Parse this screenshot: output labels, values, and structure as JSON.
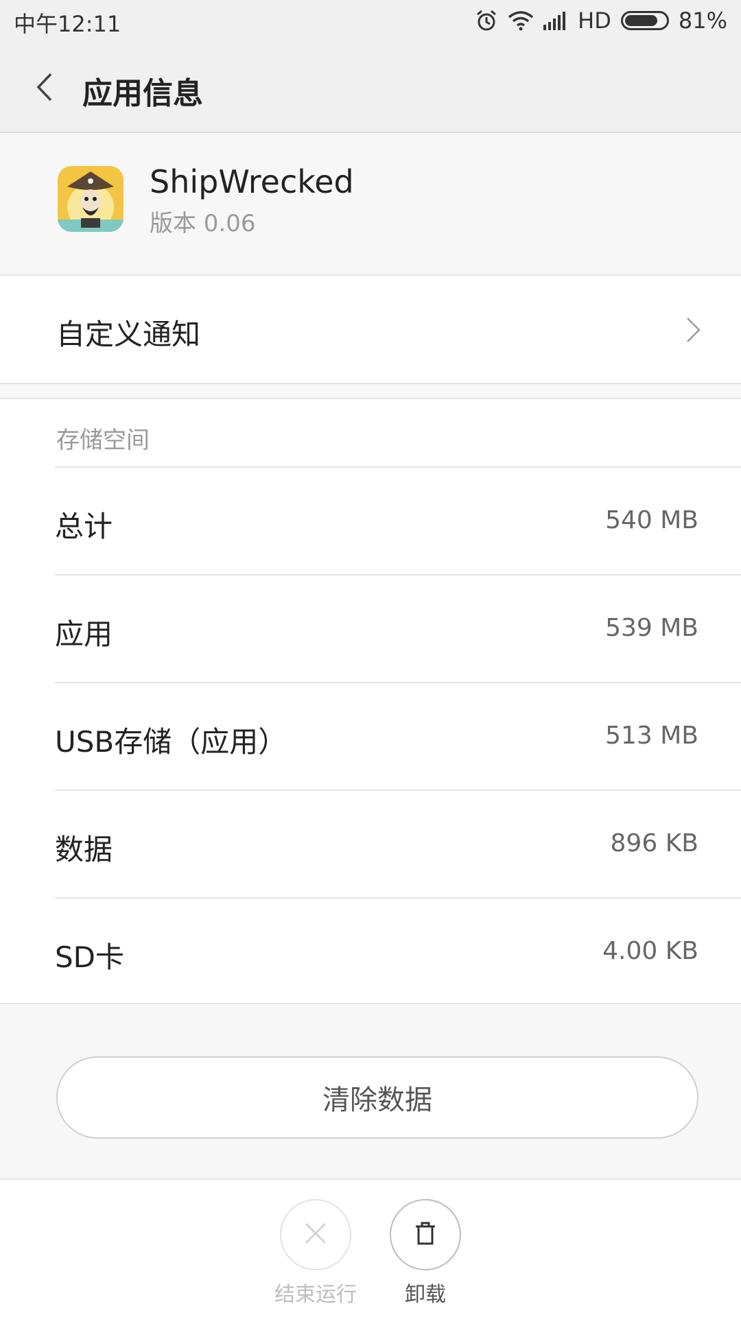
{
  "status_bar": {
    "time": "中午12:11",
    "network": "HD",
    "battery": "81%",
    "battery_level": 0.81,
    "icons": [
      "alarm-icon",
      "wifi-icon",
      "signal-icon",
      "battery-icon"
    ]
  },
  "title_bar": {
    "title": "应用信息",
    "back_icon": "back-arrow-icon"
  },
  "app": {
    "name": "ShipWrecked",
    "version": "版本 0.06",
    "icon": "pirate-app-icon"
  },
  "notification": {
    "label": "自定义通知",
    "icon": "chevron-right-icon"
  },
  "storage": {
    "header": "存储空间",
    "rows": [
      {
        "label": "总计",
        "value": "540 MB"
      },
      {
        "label": "应用",
        "value": "539 MB"
      },
      {
        "label": "USB存储（应用）",
        "value": "513 MB"
      },
      {
        "label": "数据",
        "value": "896 KB"
      },
      {
        "label": "SD卡",
        "value": "4.00 KB"
      }
    ]
  },
  "clear_data_button": "清除数据",
  "bottom_actions": {
    "force_stop": {
      "label": "结束运行",
      "icon": "close-icon",
      "enabled": false
    },
    "uninstall": {
      "label": "卸载",
      "icon": "trash-icon",
      "enabled": true
    }
  },
  "colors": {
    "header_bg": "#f0f0f0",
    "page_bg": "#f7f7f7",
    "card_bg": "#ffffff",
    "secondary_text": "#9a9a9a"
  }
}
